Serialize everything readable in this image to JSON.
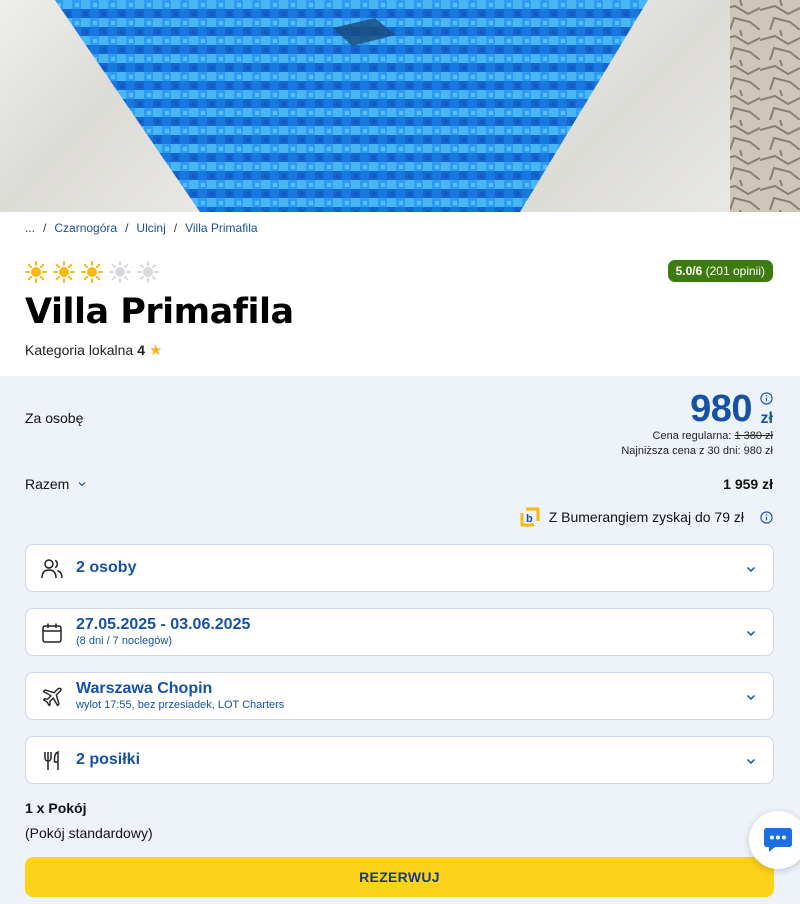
{
  "breadcrumb": {
    "dots": "...",
    "items": [
      "Czarnogóra",
      "Ulcinj",
      "Villa Primafila"
    ]
  },
  "hotel": {
    "suns_filled": 3,
    "suns_total": 5,
    "rating_score": "5.0/6",
    "rating_count": "(201 opinii)",
    "name": "Villa Primafila",
    "category_label": "Kategoria lokalna",
    "category_value": "4"
  },
  "pricing": {
    "per_person_label": "Za osobę",
    "price": "980",
    "currency": "zł",
    "regular_label": "Cena regularna:",
    "regular_value": "1 380 zł",
    "lowest_text": "Najniższa cena z 30 dni: 980 zł",
    "total_label": "Razem",
    "total_value": "1 959 zł",
    "bumerang_text": "Z Bumerangiem zyskaj do 79 zł"
  },
  "fields": {
    "persons": {
      "main": "2 osoby"
    },
    "dates": {
      "main": "27.05.2025 - 03.06.2025",
      "sub": "(8 dni / 7 noclegów)"
    },
    "flight": {
      "main": "Warszawa Chopin",
      "sub": "wylot 17:55, bez przesiadek, LOT Charters"
    },
    "meals": {
      "main": "2 posiłki"
    }
  },
  "room": {
    "count_label": "1 x Pokój",
    "type": "(Pokój standardowy)"
  },
  "actions": {
    "reserve_label": "REZERWUJ"
  },
  "icons": {
    "sun": "sun-icon",
    "people": "people-icon",
    "calendar": "calendar-icon",
    "plane": "plane-icon",
    "cutlery": "cutlery-icon",
    "chevron": "chevron-down-icon",
    "info": "info-icon",
    "chat": "chat-icon"
  },
  "colors": {
    "brand_blue": "#1552a4",
    "rating_green": "#3d7a0f",
    "cta_yellow": "#fcd21a",
    "sun_active": "#f6b90f",
    "sun_inactive": "#d7d9dd",
    "panel_bg": "#eef3fa"
  }
}
